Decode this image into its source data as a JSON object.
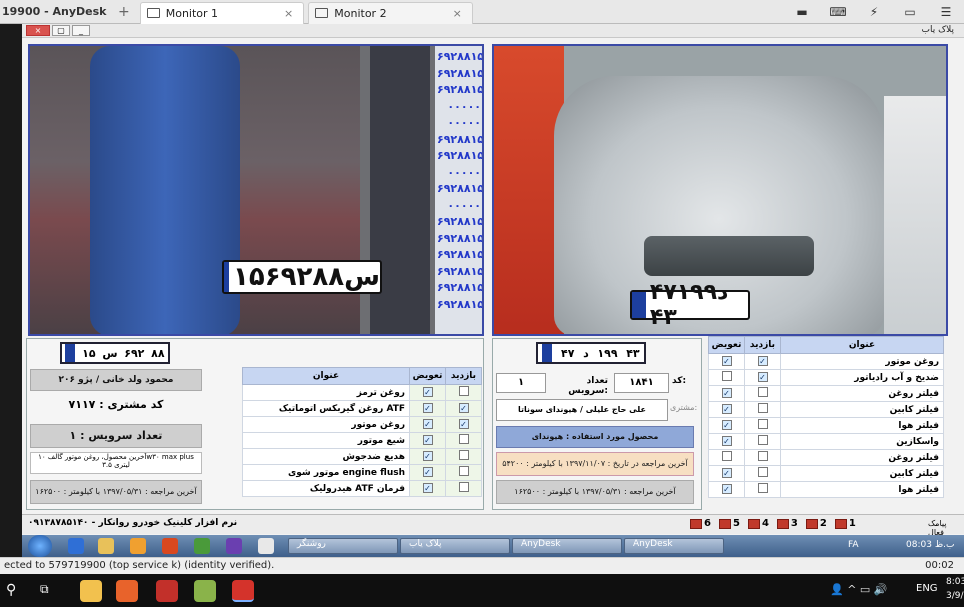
{
  "anydesk": {
    "window_title": "19900 - AnyDesk",
    "tabs": [
      {
        "label": "Monitor 1"
      },
      {
        "label": "Monitor 2"
      }
    ],
    "status_text": "ected to 579719900 (top service k) (identity verified).",
    "status_time": "00:02"
  },
  "app": {
    "title": "پلاک یاب",
    "plate_list": [
      "۶۹۲۸۸س۱۵",
      "۶۹۲۸۸س۱۵",
      "۶۹۲۸۸س۱۵",
      "۰۰۰۰۰",
      "۰۰۰۰۰",
      "۶۹۲۸۸س۱۵",
      "۶۹۲۸۸س۱۵",
      "۰۰۰۰۰",
      "۶۹۲۸۸س۱۵",
      "۰۰۰۰۰",
      "۶۹۲۸۸س۱۵",
      "۶۹۲۸۸س۱۵",
      "۶۹۲۸۸س۱۵",
      "۶۹۲۸۸س۱۵",
      "۶۹۲۸۸س۱۵",
      "۶۹۲۸۸س۱۵"
    ],
    "plate1": {
      "text": "۱۵س۶۹۲۸۸"
    },
    "plate2": {
      "text": "۴۷د۱۹۹ ۴۳"
    },
    "left": {
      "plate_small": {
        "iran": "۸۸",
        "num": "۶۹۲",
        "letter": "س",
        "code": "۱۵"
      },
      "customer": "محمود ولد خانی / پژو ۲۰۶",
      "customer_code": "کد مشتری : ۷۱۱۷",
      "service_count": "تعداد سرویس : ۱",
      "last_oil": "آخرین محصول، روغن موتور گالف ۱۰w۳۰ max plus لیتری ۳.۵",
      "last_visit": "آخرین مراجعه : ۱۳۹۷/۰۵/۳۱ با کیلومتر : ۱۶۲۵۰۰",
      "table": {
        "headers": [
          "عنوان",
          "تعویض",
          "بازدید"
        ],
        "rows": [
          {
            "name": "روغن ترمز",
            "change": true,
            "visit": false
          },
          {
            "name": "روغن گیربکس اتوماتیک ATF",
            "change": true,
            "visit": true
          },
          {
            "name": "روغن موتور",
            "change": true,
            "visit": true
          },
          {
            "name": "شیع موتور",
            "change": true,
            "visit": false
          },
          {
            "name": "هدیع ضدجوش",
            "change": true,
            "visit": false
          },
          {
            "name": "موتور شوی engine flush",
            "change": true,
            "visit": false
          },
          {
            "name": "هیدرولیک ATF فرمان",
            "change": true,
            "visit": false
          }
        ]
      }
    },
    "right": {
      "plate_small": {
        "iran": "۴۳",
        "num": "۱۹۹",
        "letter": "د",
        "code": "۴۷"
      },
      "code_label": "کد:",
      "code_value": "۱۸۴۱",
      "service_label": "تعداد سرویس:",
      "service_value": "۱",
      "customer_label": "مشتری:",
      "customer_value": "علی حاج علیلی / هیوندای سوناتا",
      "product": "محصول مورد استفاده : هیوندای",
      "last_date": "آخرین مراجعه در تاریخ : ۱۳۹۷/۱۱/۰۷ با کیلومتر : ۵۴۲۰۰",
      "last_visit": "آخرین مراجعه : ۱۳۹۷/۰۵/۳۱ با کیلومتر : ۱۶۲۵۰۰",
      "table": {
        "headers": [
          "عنوان",
          "بازدید",
          "تعویض"
        ],
        "rows": [
          {
            "name": "روغن موتور",
            "visit": true,
            "change": true
          },
          {
            "name": "ضدیخ و آب رادیاتور",
            "visit": true,
            "change": false
          },
          {
            "name": "فیلتر روغن",
            "visit": false,
            "change": true
          },
          {
            "name": "فیلتر کابین",
            "visit": false,
            "change": true
          },
          {
            "name": "فیلتر هوا",
            "visit": false,
            "change": true
          },
          {
            "name": "واسکازین",
            "visit": false,
            "change": true
          },
          {
            "name": "فیلتر روغن",
            "visit": false,
            "change": false
          },
          {
            "name": "فیلتر کابین",
            "visit": false,
            "change": true
          },
          {
            "name": "فیلتر هوا",
            "visit": false,
            "change": true
          }
        ]
      }
    },
    "footer": {
      "software": "نرم افزار کلینیک خودرو روانکار - ۰۹۱۳۸۷۸۵۱۴۰",
      "label": "پیامک فعال",
      "buttons": [
        "1",
        "2",
        "3",
        "4",
        "5",
        "6"
      ]
    }
  },
  "remote_taskbar": {
    "items": [
      "روشنگر",
      "پلاک یاب",
      "AnyDesk",
      "AnyDesk"
    ],
    "lang": "FA",
    "clock": "08:03 ب.ظ"
  },
  "windows": {
    "search_icon": "search-icon",
    "lang": "ENG",
    "time": "8:03",
    "date": "3/9/"
  }
}
